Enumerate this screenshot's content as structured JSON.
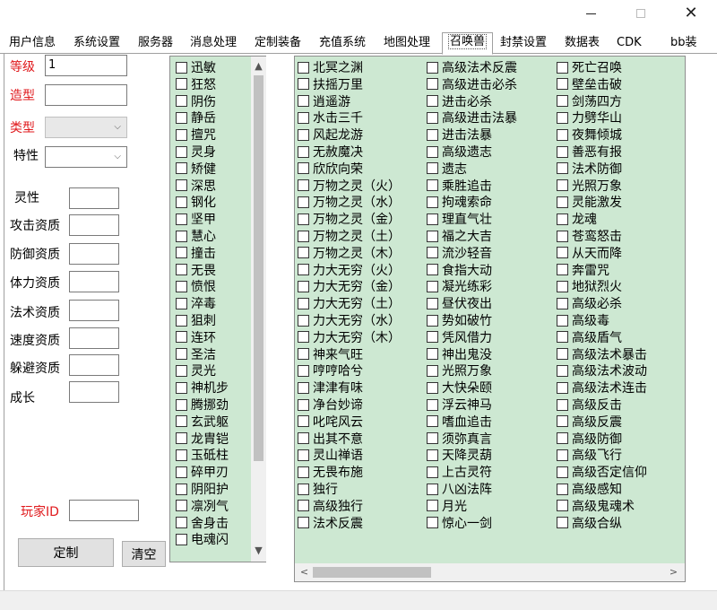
{
  "window": {
    "minimize": "—",
    "maximize": "□",
    "close": "✕"
  },
  "tabs": [
    "用户信息",
    "系统设置",
    "服务器",
    "消息处理",
    "定制装备",
    "充值系统",
    "地图处理",
    "召唤兽",
    "封禁设置",
    "数据表",
    "CDK",
    "bb装"
  ],
  "active_tab": "召唤兽",
  "form": {
    "level_label": "等级",
    "level_value": "1",
    "model_label": "造型",
    "type_label": "类型",
    "trait_label": "特性",
    "spirit_label": "灵性",
    "attack_label": "攻击资质",
    "defense_label": "防御资质",
    "stamina_label": "体力资质",
    "magic_label": "法术资质",
    "speed_label": "速度资质",
    "dodge_label": "躲避资质",
    "growth_label": "成长",
    "player_id_label": "玩家ID",
    "customize_button": "定制",
    "clear_button": "清空"
  },
  "traits_list": [
    "迅敏",
    "狂怒",
    "阴伤",
    "静岳",
    "擅咒",
    "灵身",
    "矫健",
    "深思",
    "钢化",
    "坚甲",
    "慧心",
    "撞击",
    "无畏",
    "愤恨",
    "淬毒",
    "狙刺",
    "连环",
    "圣洁",
    "灵光",
    "神机步",
    "腾挪劲",
    "玄武躯",
    "龙胄铠",
    "玉砥柱",
    "碎甲刃",
    "阴阳护",
    "凛冽气",
    "舍身击",
    "电魂闪"
  ],
  "skills_col1": [
    "北冥之渊",
    "扶摇万里",
    "逍遥游",
    "水击三千",
    "风起龙游",
    "无赦魔决",
    "欣欣向荣",
    "万物之灵（火）",
    "万物之灵（水）",
    "万物之灵（金）",
    "万物之灵（土）",
    "万物之灵（木）",
    "力大无穷（火）",
    "力大无穷（金）",
    "力大无穷（土）",
    "力大无穷（水）",
    "力大无穷（木）",
    "神来气旺",
    "哼哼哈兮",
    "津津有味",
    "净台妙谛",
    "叱咤风云",
    "出其不意",
    "灵山禅语",
    "无畏布施",
    "独行",
    "高级独行",
    "法术反震"
  ],
  "skills_col2": [
    "高级法术反震",
    "高级进击必杀",
    "进击必杀",
    "高级进击法暴",
    "进击法暴",
    "高级遗志",
    "遗志",
    "乘胜追击",
    "拘魂索命",
    "理直气壮",
    "福之大吉",
    "流沙轻音",
    "食指大动",
    "凝光练彩",
    "昼伏夜出",
    "势如破竹",
    "凭风借力",
    "神出鬼没",
    "光照万象",
    "大快朵颐",
    "浮云神马",
    "嗜血追击",
    "须弥真言",
    "天降灵葫",
    "上古灵符",
    "八凶法阵",
    "月光",
    "惊心一剑"
  ],
  "skills_col3": [
    "死亡召唤",
    "壁垒击破",
    "剑荡四方",
    "力劈华山",
    "夜舞倾城",
    "善恶有报",
    "法术防御",
    "光照万象",
    "灵能激发",
    "龙魂",
    "苍鸾怒击",
    "从天而降",
    "奔雷咒",
    "地狱烈火",
    "高级必杀",
    "高级毒",
    "高级盾气",
    "高级法术暴击",
    "高级法术波动",
    "高级法术连击",
    "高级反击",
    "高级反震",
    "高级防御",
    "高级飞行",
    "高级否定信仰",
    "高级感知",
    "高级鬼魂术",
    "高级合纵"
  ],
  "scroll": {
    "up": "▲",
    "down": "▼",
    "left": "<",
    "right": ">"
  },
  "colors": {
    "list_bg": "#cde8d2",
    "label_red": "#e0191c"
  },
  "icons": {
    "combo_arrow": "chevron-down-icon"
  }
}
